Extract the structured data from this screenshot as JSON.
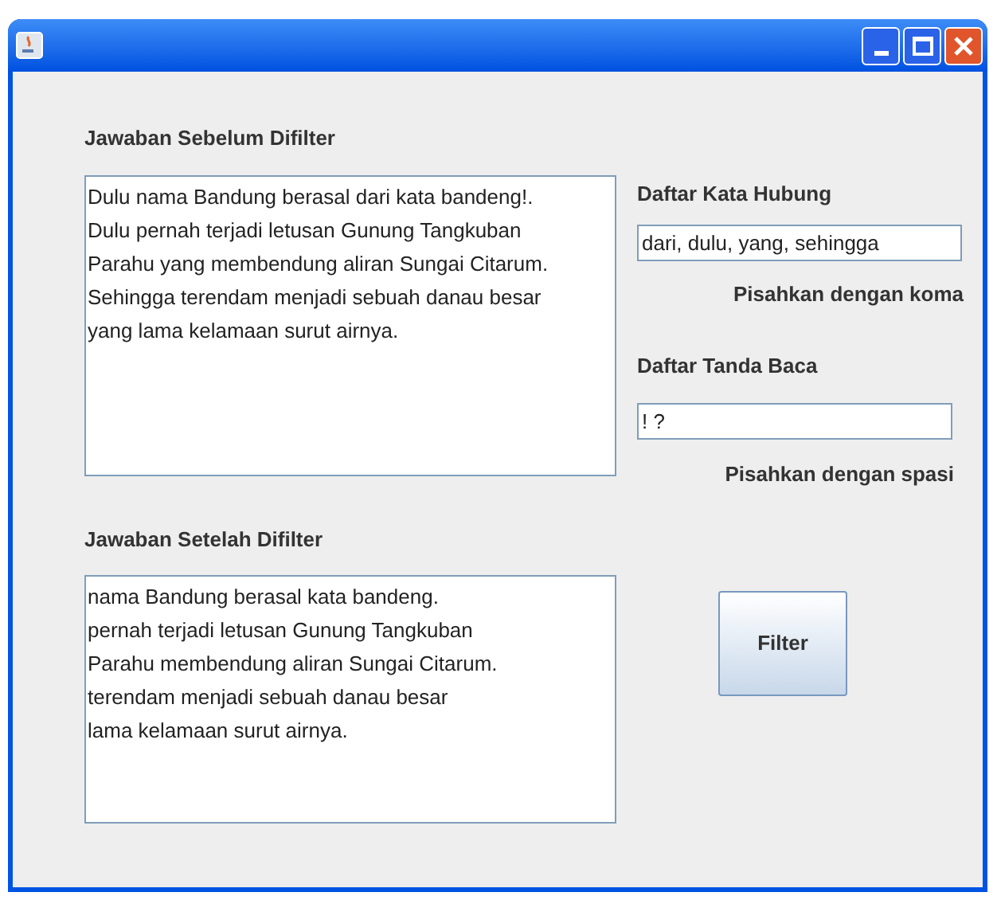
{
  "window": {
    "title_buttons": [
      {
        "kind": "minimize"
      },
      {
        "kind": "maximize"
      },
      {
        "kind": "close"
      }
    ]
  },
  "before": {
    "label": "Jawaban Sebelum Difilter",
    "text": "Dulu nama Bandung berasal dari kata bandeng!.\nDulu pernah terjadi letusan Gunung Tangkuban\nParahu yang membendung aliran Sungai Citarum.\nSehingga terendam menjadi sebuah danau besar\nyang lama kelamaan surut airnya."
  },
  "after": {
    "label": "Jawaban Setelah Difilter",
    "text": "nama Bandung berasal kata bandeng.\npernah terjadi letusan Gunung Tangkuban\nParahu membendung aliran Sungai Citarum.\nterendam menjadi sebuah danau besar\nlama kelamaan surut airnya."
  },
  "conjunctions": {
    "label": "Daftar Kata Hubung",
    "value": "dari, dulu, yang, sehingga",
    "hint": "Pisahkan dengan koma"
  },
  "punctuation": {
    "label": "Daftar Tanda Baca",
    "value": "! ?",
    "hint": "Pisahkan dengan spasi"
  },
  "button": "Filter"
}
